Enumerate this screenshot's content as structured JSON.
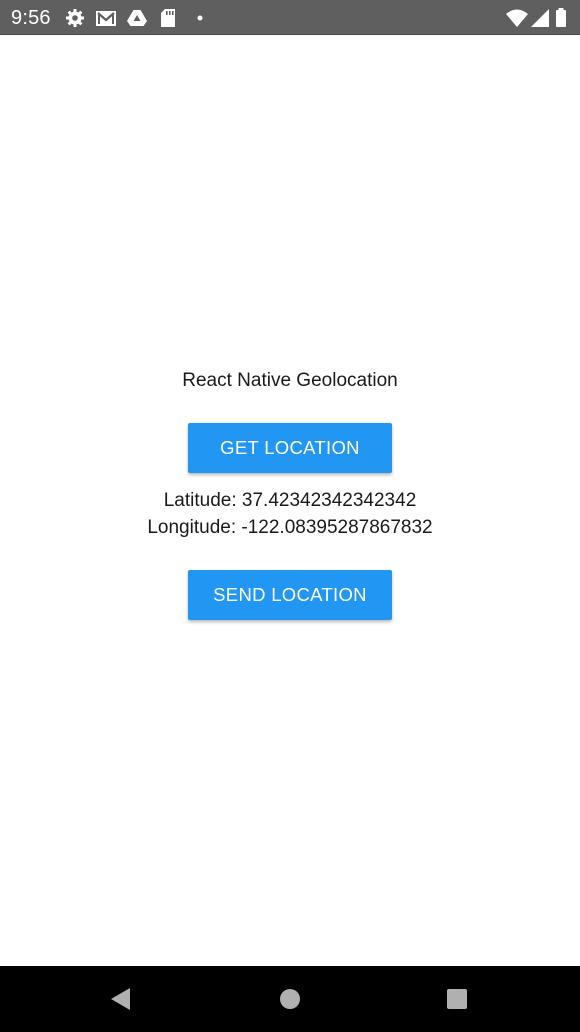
{
  "status_bar": {
    "time": "9:56",
    "icons": [
      "settings-icon",
      "gmail-icon",
      "drive-icon",
      "sd-card-icon",
      "notification-dot-icon",
      "wifi-icon",
      "signal-icon",
      "battery-icon"
    ]
  },
  "app": {
    "title": "React Native Geolocation",
    "get_location_label": "GET LOCATION",
    "latitude_text": "Latitude: 37.42342342342342",
    "longitude_text": "Longitude: -122.08395287867832",
    "send_location_label": "SEND LOCATION"
  },
  "nav_bar": {
    "buttons": [
      "back-icon",
      "home-icon",
      "recents-icon"
    ]
  },
  "colors": {
    "button_bg": "#2196f3",
    "status_bar_bg": "#5f5f5f",
    "nav_bar_bg": "#000000"
  }
}
